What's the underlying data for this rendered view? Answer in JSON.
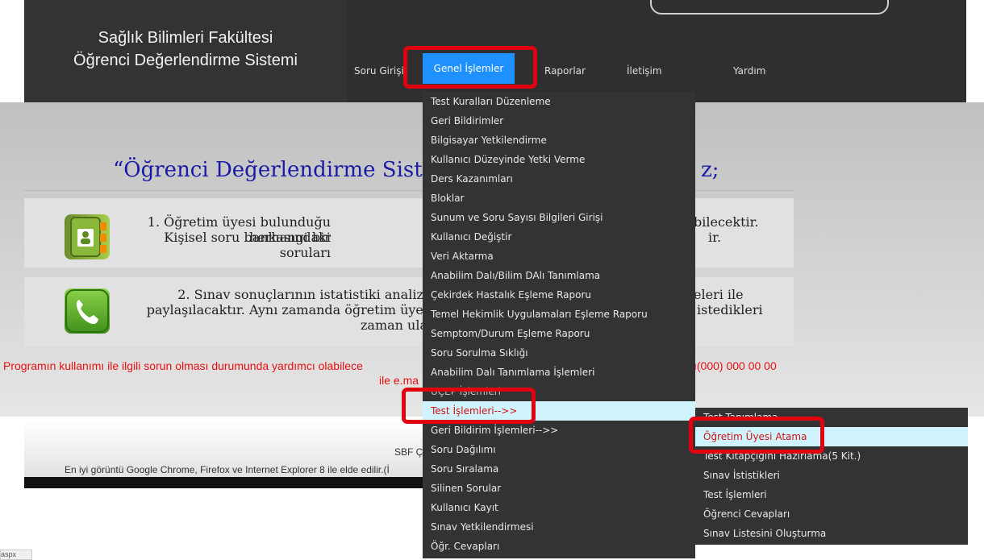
{
  "brand": {
    "line1": "Sağlık Bilimleri Fakültesi",
    "line2": "Öğrenci Değerlendirme Sistemi"
  },
  "nav": {
    "soru": "Soru Girişi",
    "genel": "Genel İşlemler",
    "raporlar": "Raporlar",
    "iletisim": "İletişim",
    "yardim": "Yardım"
  },
  "welcome": "“Öğrenci Değerlendirme Siste",
  "welcome_tail": "z;",
  "panel1": {
    "line1a": "1. Öğretim üyesi bulunduğu herhangi bir",
    "line1b": "bilecektir.",
    "line2a": "Kişisel soru bankasındaki soruları",
    "line2b": "ir."
  },
  "panel2": {
    "line1a": "2. Sınav sonuçlarının istatistiki analizi",
    "line1b": "eleri ile",
    "line2a": "paylaşılacaktır. Aynı zamanda öğretim üyel",
    "line2b": "istedikleri",
    "line3": "zaman ula"
  },
  "notice": {
    "left": "Programın kullanımı ile ilgili sorun olması durumunda yardımcı olabilece",
    "right": "ı(000) 000 00 00",
    "line2": "ile e.ma"
  },
  "footer": {
    "line1": "SBF Ç",
    "line2": "En iyi görüntü Google Chrome, Firefox  ve  Internet Explorer 8 ile elde edilir.(İ"
  },
  "corner_text": "aspx",
  "dropdown": {
    "items": [
      "Test Kuralları Düzenleme",
      "Geri Bildirimler",
      "Bilgisayar Yetkilendirme",
      "Kullanıcı Düzeyinde Yetki Verme",
      "Ders Kazanımları",
      "Bloklar",
      "Sunum ve Soru Sayısı Bilgileri Girişi",
      "Kullanıcı Değiştir",
      "Veri Aktarma",
      "Anabilim Dalı/Bilim DAlı Tanımlama",
      "Çekirdek Hastalık Eşleme Raporu",
      "Temel Hekimlik Uygulamaları Eşleme Raporu",
      "Semptom/Durum Eşleme Raporu",
      "Soru Sorulma Sıklığı",
      "Anabilim Dalı Tanımlama İşlemleri",
      "UÇEP İşlemleri",
      "Test İşlemleri-->>",
      "Geri Bildirim İşlemleri-->>",
      "Soru Dağılımı",
      "Soru Sıralama",
      "Silinen Sorular",
      "Kullanıcı Kayıt",
      "Sınav Yetkilendirmesi",
      "Öğr. Cevapları"
    ]
  },
  "submenu": {
    "items": [
      "Test Tanımlama",
      "Öğretim Üyesi Atama",
      "Test Kitapçığını Hazırlama(5 Kit.)",
      "Sınav İstistikleri",
      "Test İşlemleri",
      "Öğrenci Cevapları",
      "Sınav Listesini Oluşturma"
    ]
  },
  "colors": {
    "nav_active": "#1e90ff",
    "highlight_box": "#e0000f",
    "notice": "#e81010",
    "title": "#1a1aa8",
    "menu_bg": "#333333",
    "menu_active_bg": "#cff4ff"
  }
}
